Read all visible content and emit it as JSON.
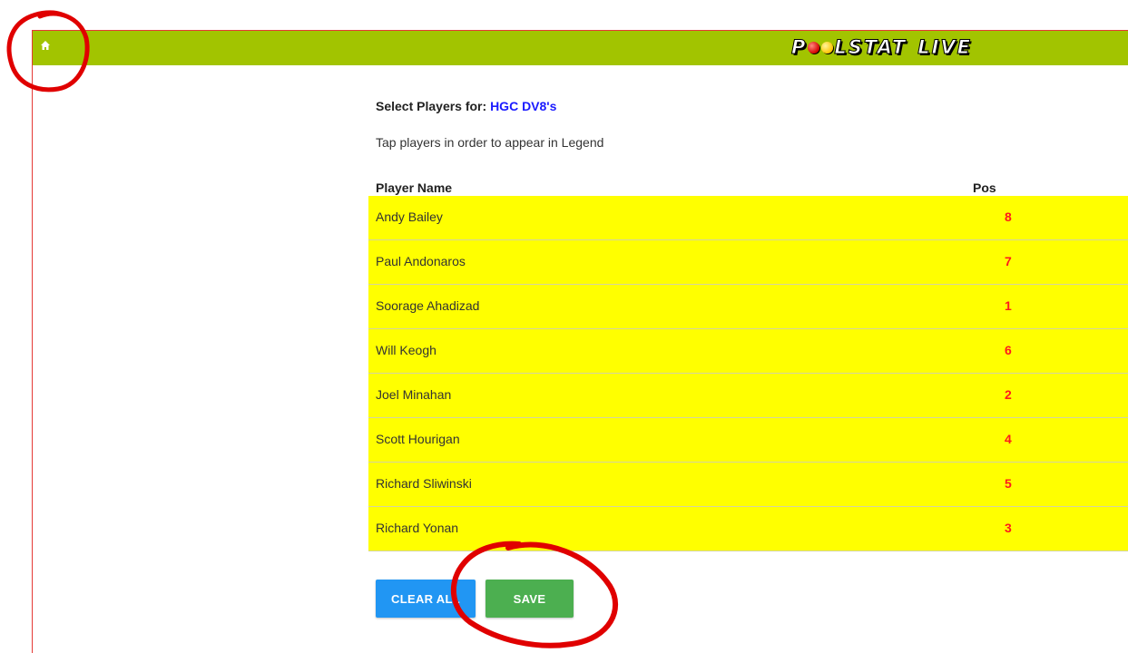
{
  "header": {
    "logo_prefix": "P",
    "logo_suffix": "LSTAT",
    "logo_live": "LIVE",
    "home_icon": "home-icon",
    "background_color": "#a2c400"
  },
  "page": {
    "select_label": "Select Players for: ",
    "team_name": "HGC DV8's",
    "instructions": "Tap players in order to appear in Legend"
  },
  "table": {
    "columns": [
      "Player Name",
      "Pos"
    ],
    "rows": [
      {
        "name": "Andy Bailey",
        "pos": "8"
      },
      {
        "name": "Paul Andonaros",
        "pos": "7"
      },
      {
        "name": "Soorage Ahadizad",
        "pos": "1"
      },
      {
        "name": "Will Keogh",
        "pos": "6"
      },
      {
        "name": "Joel Minahan",
        "pos": "2"
      },
      {
        "name": "Scott Hourigan",
        "pos": "4"
      },
      {
        "name": "Richard Sliwinski",
        "pos": "5"
      },
      {
        "name": "Richard Yonan",
        "pos": "3"
      }
    ],
    "row_color": "#ffff00",
    "pos_color": "#ff1a1a"
  },
  "actions": {
    "clear_label": "CLEAR ALL",
    "save_label": "SAVE",
    "clear_color": "#2196f3",
    "save_color": "#4caf50"
  }
}
